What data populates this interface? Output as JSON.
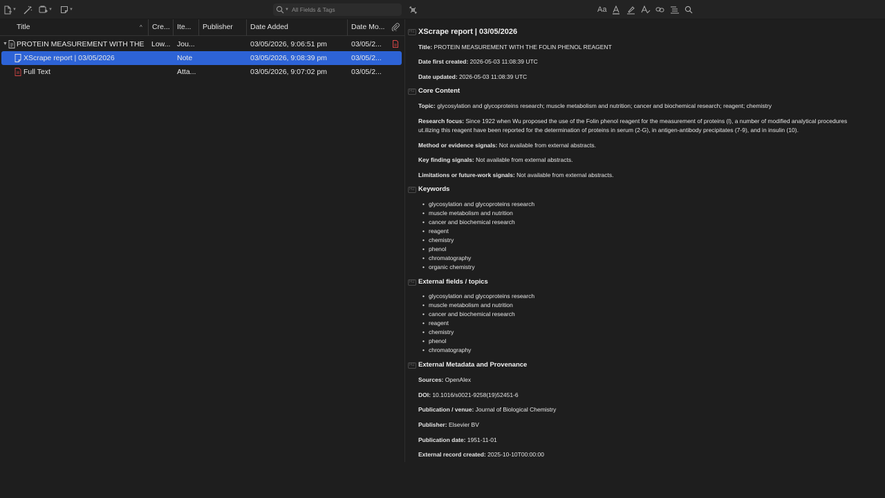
{
  "search": {
    "placeholder": "All Fields & Tags"
  },
  "columns": [
    "Title",
    "Cre...",
    "Ite...",
    "Publisher",
    "Date Added",
    "Date Mo..."
  ],
  "rows": [
    {
      "title": "PROTEIN MEASUREMENT WITH THE ...",
      "creator": "Low...",
      "item_type": "Jou...",
      "publisher": "",
      "date_added": "03/05/2026, 9:06:51 pm",
      "date_modified": "03/05/2...",
      "selected": false
    },
    {
      "title": "XScrape report | 03/05/2026",
      "creator": "",
      "item_type": "Note",
      "publisher": "",
      "date_added": "03/05/2026, 9:08:39 pm",
      "date_modified": "03/05/2...",
      "selected": true
    },
    {
      "title": "Full Text",
      "creator": "",
      "item_type": "Atta...",
      "publisher": "",
      "date_added": "03/05/2026, 9:07:02 pm",
      "date_modified": "03/05/2...",
      "selected": false
    }
  ],
  "note_toolbar": {
    "format_text": "Aa"
  },
  "note": {
    "title": "XScrape report | 03/05/2026",
    "meta": [
      {
        "label": "Title:",
        "value": "PROTEIN MEASUREMENT WITH THE FOLIN PHENOL REAGENT"
      },
      {
        "label": "Date first created:",
        "value": "2026-05-03 11:08:39 UTC"
      },
      {
        "label": "Date updated:",
        "value": "2026-05-03 11:08:39 UTC"
      }
    ],
    "core_heading": "Core Content",
    "core": [
      {
        "label": "Topic:",
        "value": "glycosylation and glycoproteins research; muscle metabolism and nutrition; cancer and biochemical research; reagent; chemistry"
      },
      {
        "label": "Research focus:",
        "value": "Since 1922 when Wu proposed the use of the Folin phenol reagent for the measurement of proteins (l), a number of modified analytical procedures ut.ilizing this reagent have been reported for the determination of proteins in serum (2-G), in antigen-antibody precipitates (7-9), and in insulin (10)."
      },
      {
        "label": "Method or evidence signals:",
        "value": "Not available from external abstracts."
      },
      {
        "label": "Key finding signals:",
        "value": "Not available from external abstracts."
      },
      {
        "label": "Limitations or future-work signals:",
        "value": "Not available from external abstracts."
      }
    ],
    "keywords_heading": "Keywords",
    "keywords": [
      "glycosylation and glycoproteins research",
      "muscle metabolism and nutrition",
      "cancer and biochemical research",
      "reagent",
      "chemistry",
      "phenol",
      "chromatography",
      "organic chemistry"
    ],
    "fields_heading": "External fields / topics",
    "fields": [
      "glycosylation and glycoproteins research",
      "muscle metabolism and nutrition",
      "cancer and biochemical research",
      "reagent",
      "chemistry",
      "phenol",
      "chromatography"
    ],
    "provenance_heading": "External Metadata and Provenance",
    "provenance": [
      {
        "label": "Sources:",
        "value": "OpenAlex"
      },
      {
        "label": "DOI:",
        "value": "10.1016/s0021-9258(19)52451-6"
      },
      {
        "label": "Publication / venue:",
        "value": "Journal of Biological Chemistry"
      },
      {
        "label": "Publisher:",
        "value": "Elsevier BV"
      },
      {
        "label": "Publication date:",
        "value": "1951-11-01"
      },
      {
        "label": "External record created:",
        "value": "2025-10-10T00:00:00"
      }
    ]
  },
  "colors": {
    "selection": "#2d63d6",
    "pdf_icon": "#d64545",
    "background": "#1e1e1e"
  }
}
